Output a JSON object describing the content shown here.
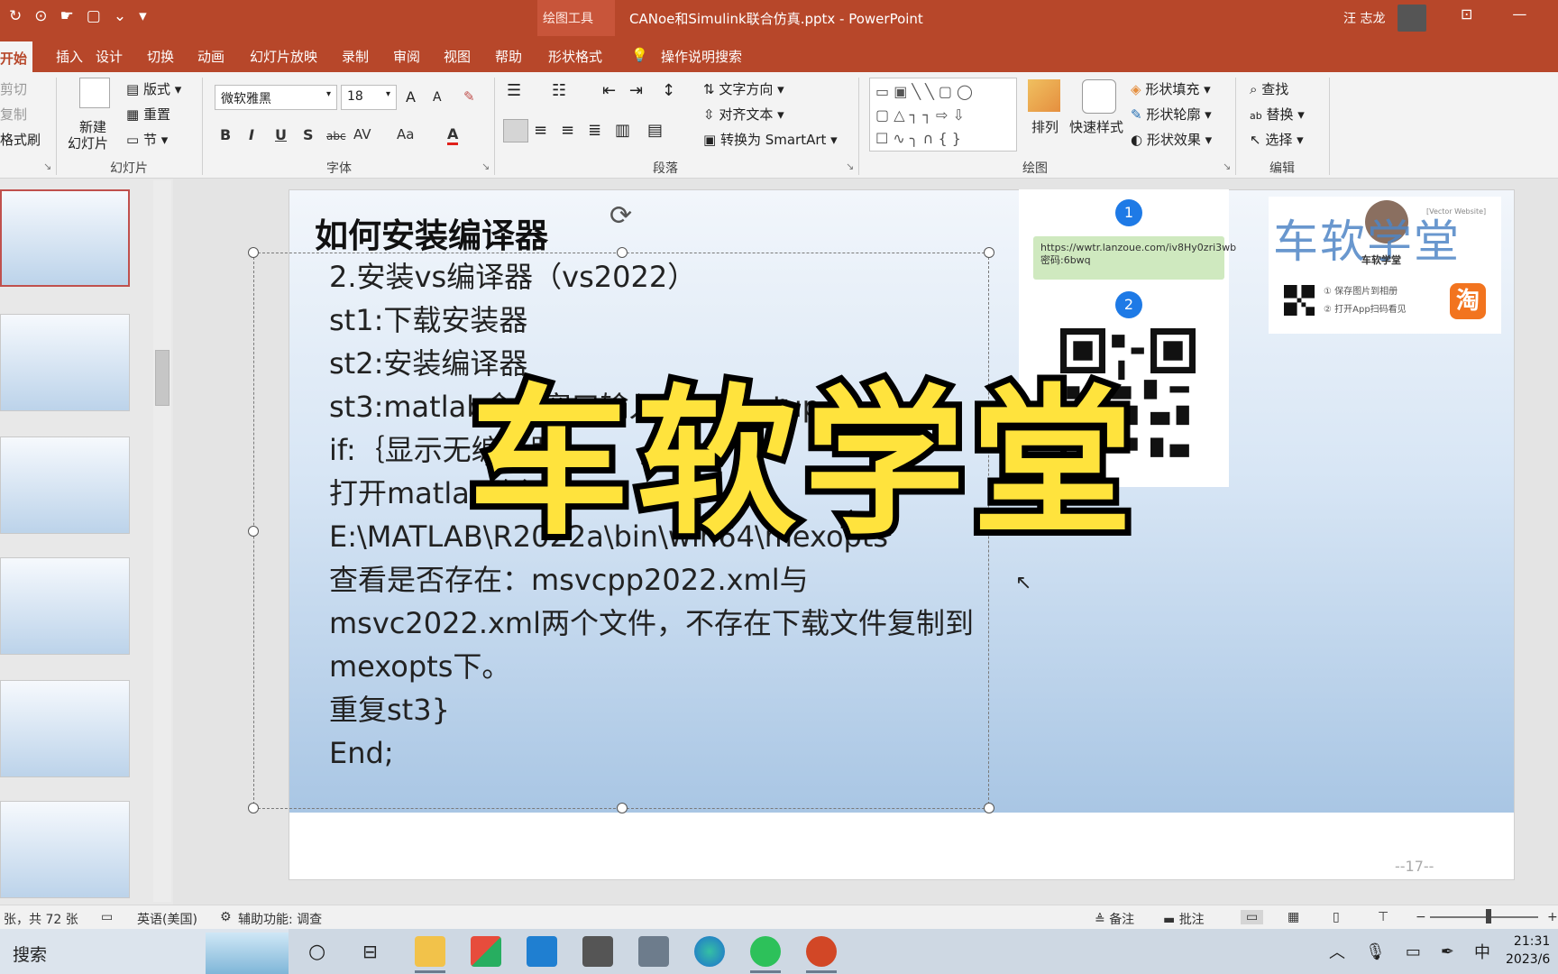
{
  "titlebar": {
    "context_tab": "绘图工具",
    "document_title": "CANoe和Simulink联合仿真.pptx  -  PowerPoint",
    "user": "汪 志龙",
    "quick_access": [
      "↻",
      "⊙",
      "☛",
      "▢",
      "⌄",
      "▾"
    ],
    "window_buttons": [
      "⊡",
      "—"
    ]
  },
  "menu": {
    "tabs": [
      "开始",
      "插入",
      "设计",
      "切换",
      "动画",
      "幻灯片放映",
      "录制",
      "审阅",
      "视图",
      "帮助",
      "形状格式"
    ],
    "tell_me": "操作说明搜索"
  },
  "ribbon": {
    "clipboard": {
      "cut": "剪切",
      "copy": "复制",
      "format_painter": "格式刷"
    },
    "slides": {
      "new_slide_1": "新建",
      "new_slide_2": "幻灯片",
      "layout": "版式",
      "reset": "重置",
      "section": "节",
      "group_label": "幻灯片"
    },
    "font": {
      "name": "微软雅黑",
      "size": "18",
      "group_label": "字体",
      "bold": "B",
      "italic": "I",
      "underline": "U",
      "shadow": "S",
      "strike": "abc",
      "spacing": "AV",
      "case": "Aa",
      "color": "A",
      "grow": "A",
      "shrink": "A"
    },
    "paragraph": {
      "text_direction": "文字方向",
      "align_text": "对齐文本",
      "smartart": "转换为 SmartArt",
      "group_label": "段落"
    },
    "drawing": {
      "arrange": "排列",
      "quick_styles": "快速样式",
      "shape_fill": "形状填充",
      "shape_outline": "形状轮廓",
      "shape_effects": "形状效果",
      "group_label": "绘图"
    },
    "editing": {
      "find": "查找",
      "replace": "替换",
      "select": "选择",
      "group_label": "编辑"
    }
  },
  "slide": {
    "title": "如何安装编译器",
    "body_lines": [
      "2.安装vs编译器（vs2022）",
      "    st1:下载安装器",
      "    st2:安装编译器",
      "    st3:matlab命令窗口输入mex -setup –",
      "    if:｛显示无编译器",
      "         打开matlab路径：",
      "       E:\\MATLAB\\R2022a\\bin\\win64\\mexopts",
      "      查看是否存在：msvcpp2022.xml与",
      "msvc2022.xml两个文件，不存在下载文件复制到",
      "mexopts下。",
      "       重复st3}",
      "End;"
    ],
    "page_number": "--17--",
    "watermark": "车软学堂",
    "qr_badge_1": "1",
    "qr_badge_2": "2",
    "link_text": "https://wwtr.lanzoue.com/iv8Hy0zri3wb",
    "password_text": "密码:6bwq",
    "brand_title": "车软学堂",
    "brand_sub": "车软学堂",
    "brand_tip_1": "① 保存图片到相册",
    "brand_tip_2": "② 打开App扫码看见",
    "vector_tag": "[Vector Website]",
    "taobao": "淘"
  },
  "statusbar": {
    "slide_count": "张，共 72 张",
    "language": "英语(美国)",
    "accessibility": "辅助功能: 调查",
    "notes": "备注",
    "comments": "批注"
  },
  "taskbar": {
    "search": "搜索",
    "time": "21:31",
    "date": "2023/6",
    "ime": "中"
  },
  "colors": {
    "accent": "#b7472a",
    "watermark_fill": "#ffe33d",
    "badge": "#1e7ae6"
  }
}
